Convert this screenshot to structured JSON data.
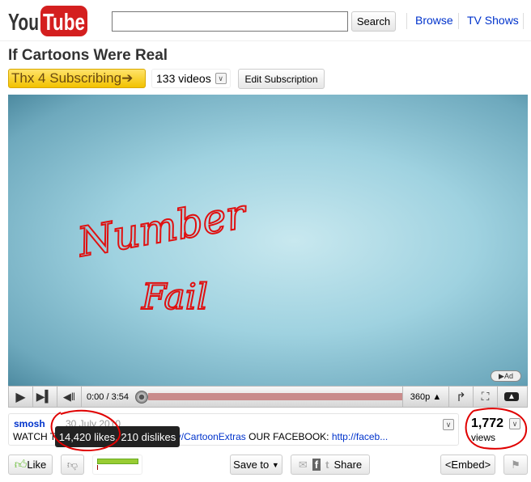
{
  "header": {
    "logo": "YouTube",
    "search_value": "",
    "search_button": "Search",
    "nav": [
      "Browse",
      "TV Shows"
    ]
  },
  "channel": {
    "title": "If Cartoons Were Real",
    "subscribe_label": "Thx 4 Subscribing",
    "videos_count": "133 videos",
    "edit_subscription": "Edit Subscription"
  },
  "video": {
    "overlay_text": [
      "Number",
      "Fail"
    ],
    "ad_label": "Ad",
    "time": "0:00 / 3:54",
    "quality": "360p",
    "progress": 0
  },
  "info": {
    "uploader": "smosh",
    "date": "30 July 2010",
    "desc_prefix": "WATCH T",
    "desc_link": "ly/CartoonExtras",
    "desc_mid": " OUR FACEBOOK: ",
    "desc_link2": "http://faceb...",
    "views_count": "1,772",
    "views_label": "views",
    "tooltip": "14,420 likes, 210 dislikes"
  },
  "actions": {
    "like": "Like",
    "save_to": "Save to",
    "share": "Share",
    "embed": "<Embed>",
    "like_ratio": 0.985
  },
  "colors": {
    "accent": "#03c",
    "annotation": "#e00000",
    "like_bar": "#9c3"
  }
}
